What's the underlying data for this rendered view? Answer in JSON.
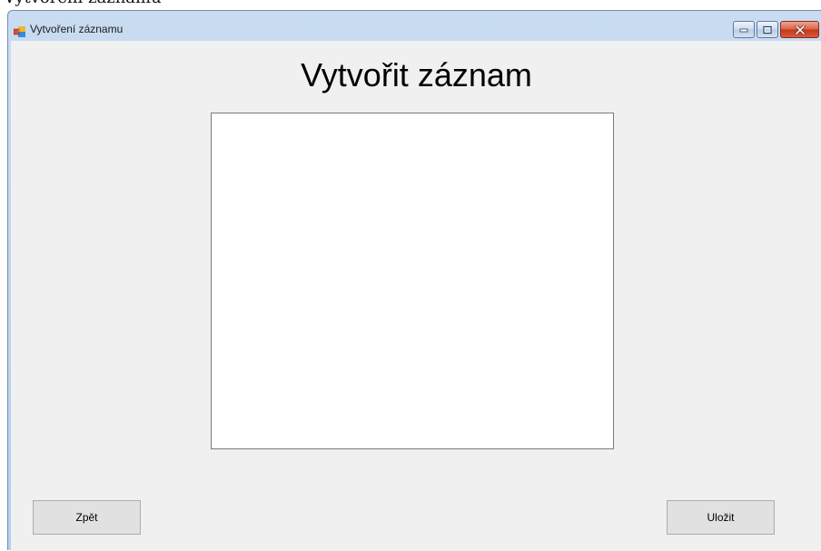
{
  "outer_caption": "Vytvoření záznamu",
  "window": {
    "title": "Vytvoření záznamu",
    "controls": {
      "minimize_icon": "minimize-icon",
      "maximize_icon": "maximize-icon",
      "close_icon": "close-icon"
    }
  },
  "form": {
    "heading": "Vytvořit záznam",
    "text_value": "",
    "back_label": "Zpět",
    "save_label": "Uložit"
  },
  "colors": {
    "client_background": "#f0f0f0",
    "button_face": "#e1e1e1",
    "close_button": "#c5381a"
  }
}
